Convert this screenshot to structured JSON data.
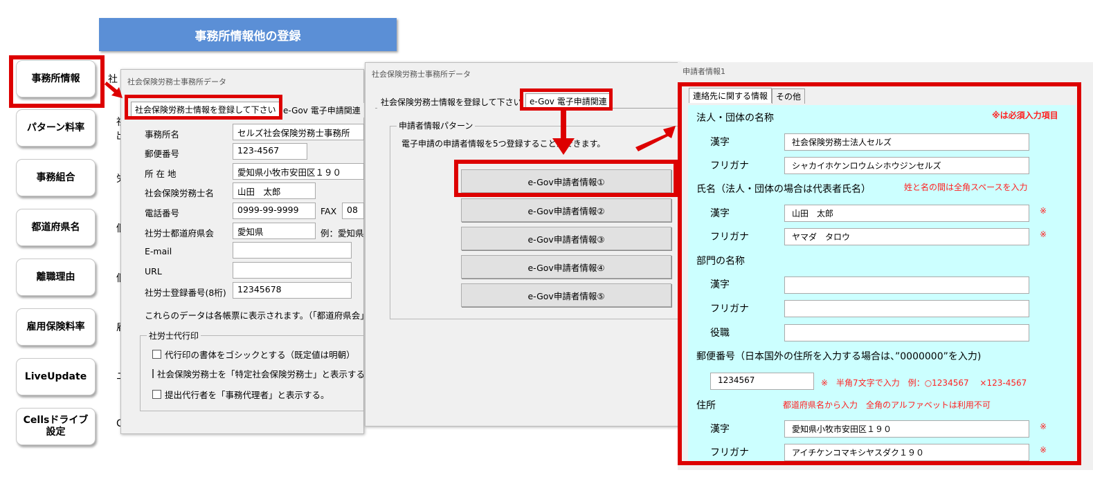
{
  "header": {
    "title": "事務所情報他の登録"
  },
  "sidebar": {
    "items": [
      {
        "label": "事務所情報"
      },
      {
        "label": "パターン料率"
      },
      {
        "label": "事務組合"
      },
      {
        "label": "都道府県名"
      },
      {
        "label": "離職理由"
      },
      {
        "label": "雇用保険料率"
      },
      {
        "label": "LiveUpdate"
      },
      {
        "label1": "Cellsドライブ",
        "label2": "設定"
      }
    ]
  },
  "behind": {
    "chars": [
      "社",
      "社",
      "出",
      "労",
      "個",
      "個",
      "雇",
      "ユ",
      "C"
    ]
  },
  "office_window": {
    "title": "社会保険労務士事務所データ",
    "tabs": [
      "社会保険労務士情報を登録して下さい",
      "e-Gov 電子申請関連"
    ],
    "fields": [
      {
        "label": "事務所名",
        "value": "セルズ社会保険労務士事務所"
      },
      {
        "label": "郵便番号",
        "value": "123-4567"
      },
      {
        "label": "所 在 地",
        "value": "愛知県小牧市安田区１９０"
      },
      {
        "label": "社会保険労務士名",
        "value": "山田　太郎"
      },
      {
        "label": "電話番号",
        "value": "0999-99-9999",
        "fax_label": "FAX",
        "fax_value": "08"
      },
      {
        "label": "社労士都道府県会",
        "value": "愛知県",
        "hint": "例：愛知県"
      },
      {
        "label": "E-mail",
        "value": ""
      },
      {
        "label": "URL",
        "value": ""
      },
      {
        "label": "社労士登録番号(8桁)",
        "value": "12345678"
      }
    ],
    "note": "これらのデータは各帳票に表示されます。（「都道府県会」",
    "group": {
      "legend": "社労士代行印",
      "options": [
        "代行印の書体をゴシックとする（既定値は明朝）",
        "社会保険労務士を「特定社会保険労務士」と表示する",
        "提出代行者を「事務代理者」と表示する。"
      ]
    }
  },
  "egov_window": {
    "title": "社会保険労務士事務所データ",
    "tabs": [
      "社会保険労務士情報を登録して下さい",
      "e-Gov 電子申請関連"
    ],
    "group": {
      "legend": "申請者情報パターン",
      "text": "電子申請の申請者情報を5つ登録することができます。"
    },
    "buttons": [
      "e-Gov申請者情報①",
      "e-Gov申請者情報②",
      "e-Gov申請者情報③",
      "e-Gov申請者情報④",
      "e-Gov申請者情報⑤"
    ]
  },
  "applicant_window": {
    "title": "申請者情報1",
    "tabs": [
      "連絡先に関する情報",
      "その他"
    ],
    "required_note": "※は必須入力項目",
    "org_heading": "法人・団体の名称",
    "org_kanji_label": "漢字",
    "org_kanji_value": "社会保険労務士法人セルズ",
    "org_kana_label": "フリガナ",
    "org_kana_value": "シャカイホケンロウムシホウジンセルズ",
    "name_heading": "氏名（法人・団体の場合は代表者氏名）",
    "name_note": "姓と名の間は全角スペースを入力",
    "name_kanji_label": "漢字",
    "name_kanji_value": "山田　太郎",
    "name_kana_label": "フリガナ",
    "name_kana_value": "ヤマダ　タロウ",
    "asterisk": "※",
    "dept_heading": "部門の名称",
    "dept_kanji_label": "漢字",
    "dept_kanji_value": "",
    "dept_kana_label": "フリガナ",
    "dept_kana_value": "",
    "dept_title_label": "役職",
    "dept_title_value": "",
    "postal_heading": "郵便番号（日本国外の住所を入力する場合は、”0000000”を入力)",
    "postal_value": "1234567",
    "postal_note": "※　半角7文字で入力　例：○1234567　 ×123-4567",
    "address_heading": "住所",
    "address_note": "都道府県名から入力　全角のアルファベットは利用不可",
    "address_kanji_label": "漢字",
    "address_kanji_value": "愛知県小牧市安田区１９０",
    "address_kana_label": "フリガナ",
    "address_kana_value": "アイチケンコマキシヤスダク１９０"
  },
  "colors": {
    "header_blue": "#5b8fd6",
    "highlight_red": "#dd0000",
    "panel_cyan": "#ccffff",
    "note_red": "#ff2020"
  }
}
